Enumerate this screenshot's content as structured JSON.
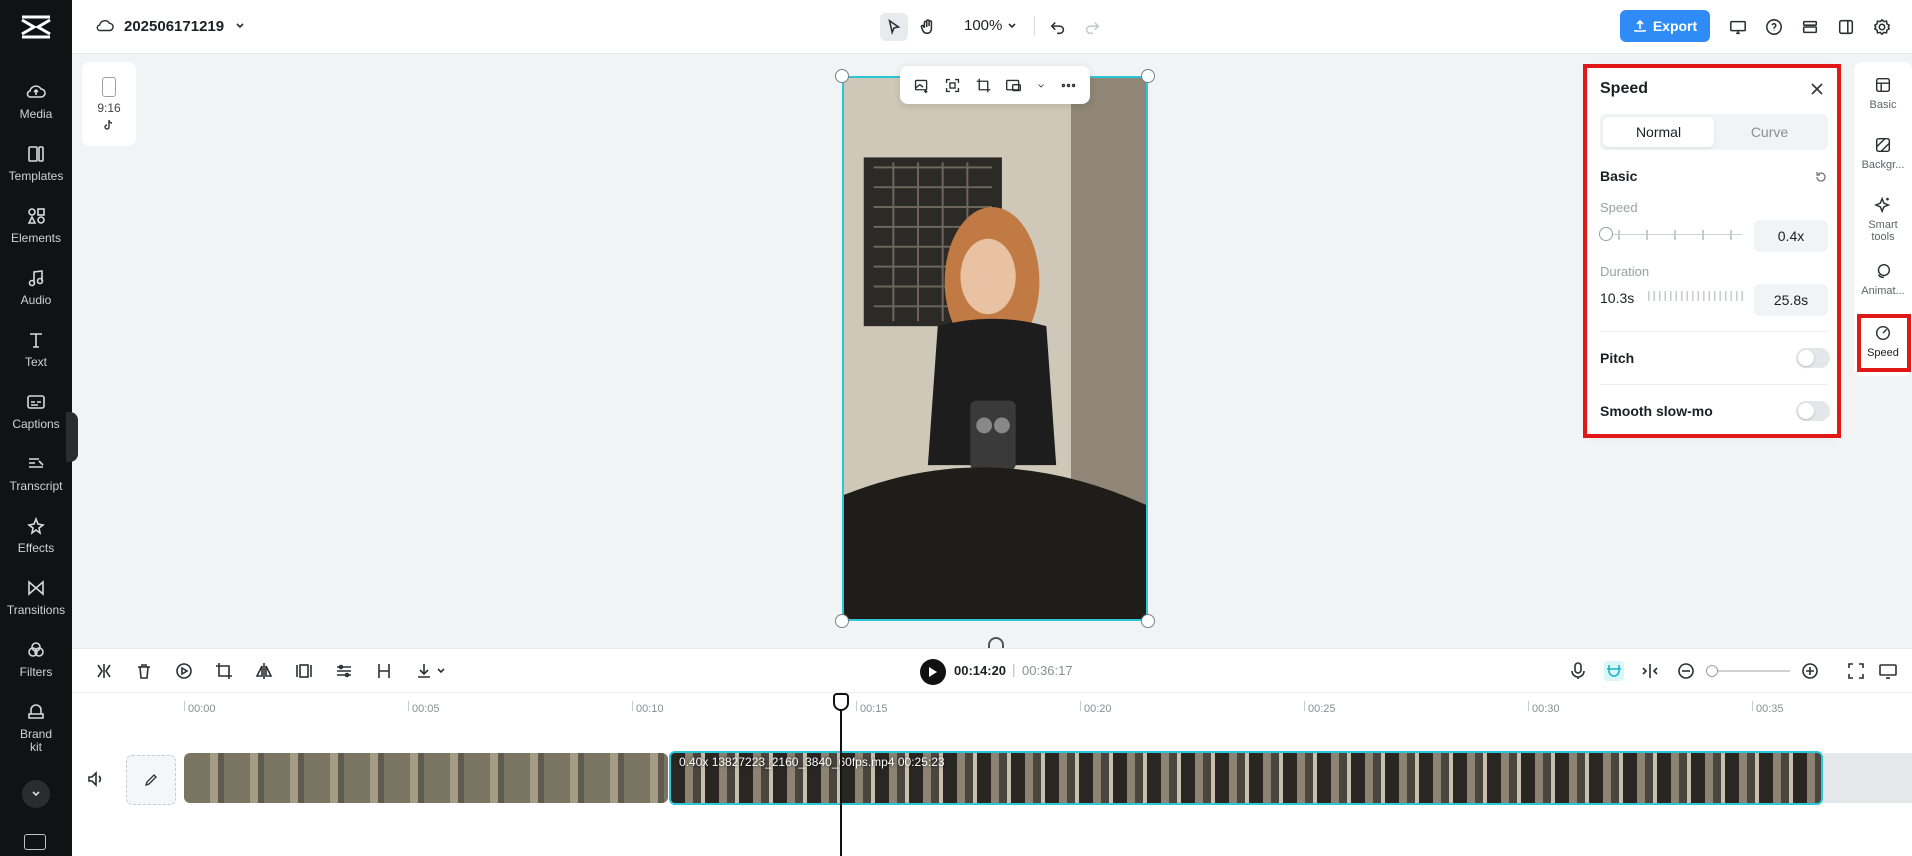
{
  "app": {
    "project_name": "202506171219",
    "zoom_level": "100%",
    "export_label": "Export"
  },
  "sidebar": {
    "items": [
      {
        "label": "Media",
        "icon": "cloud-upload-icon"
      },
      {
        "label": "Templates",
        "icon": "templates-icon"
      },
      {
        "label": "Elements",
        "icon": "elements-icon"
      },
      {
        "label": "Audio",
        "icon": "music-note-icon"
      },
      {
        "label": "Text",
        "icon": "text-icon"
      },
      {
        "label": "Captions",
        "icon": "captions-icon"
      },
      {
        "label": "Transcript",
        "icon": "transcript-icon"
      },
      {
        "label": "Effects",
        "icon": "effects-star-icon"
      },
      {
        "label": "Transitions",
        "icon": "transitions-icon"
      },
      {
        "label": "Filters",
        "icon": "filters-icon"
      },
      {
        "label": "Brand kit",
        "icon": "brand-kit-icon"
      }
    ]
  },
  "canvas": {
    "aspect_ratio": "9:16",
    "platform_icon": "tiktok-icon"
  },
  "speed_panel": {
    "title": "Speed",
    "tabs": [
      {
        "label": "Normal",
        "active": true
      },
      {
        "label": "Curve",
        "active": false
      }
    ],
    "section_basic": "Basic",
    "speed_label": "Speed",
    "speed_value": "0.4x",
    "duration_label": "Duration",
    "duration_original": "10.3s",
    "duration_value": "25.8s",
    "pitch_label": "Pitch",
    "pitch_on": false,
    "smooth_label": "Smooth slow-mo",
    "smooth_on": false
  },
  "properties": {
    "items": [
      {
        "label": "Basic",
        "icon": "basic-icon"
      },
      {
        "label": "Backgr...",
        "icon": "background-icon"
      },
      {
        "label": "Smart tools",
        "icon": "smart-tools-icon"
      },
      {
        "label": "Animat...",
        "icon": "animation-icon"
      },
      {
        "label": "Speed",
        "icon": "speed-icon"
      }
    ]
  },
  "timeline": {
    "current_time": "00:14:20",
    "separator": "|",
    "total_time": "00:36:17",
    "ruler": [
      "00:00",
      "00:05",
      "00:10",
      "00:15",
      "00:20",
      "00:25",
      "00:30",
      "00:35"
    ],
    "clip_label": "0.40x  13827223_2160_3840_60fps.mp4  00:25:23"
  },
  "colors": {
    "accent": "#2dc6d6",
    "export": "#2f8cf6",
    "highlight": "#e01818"
  }
}
